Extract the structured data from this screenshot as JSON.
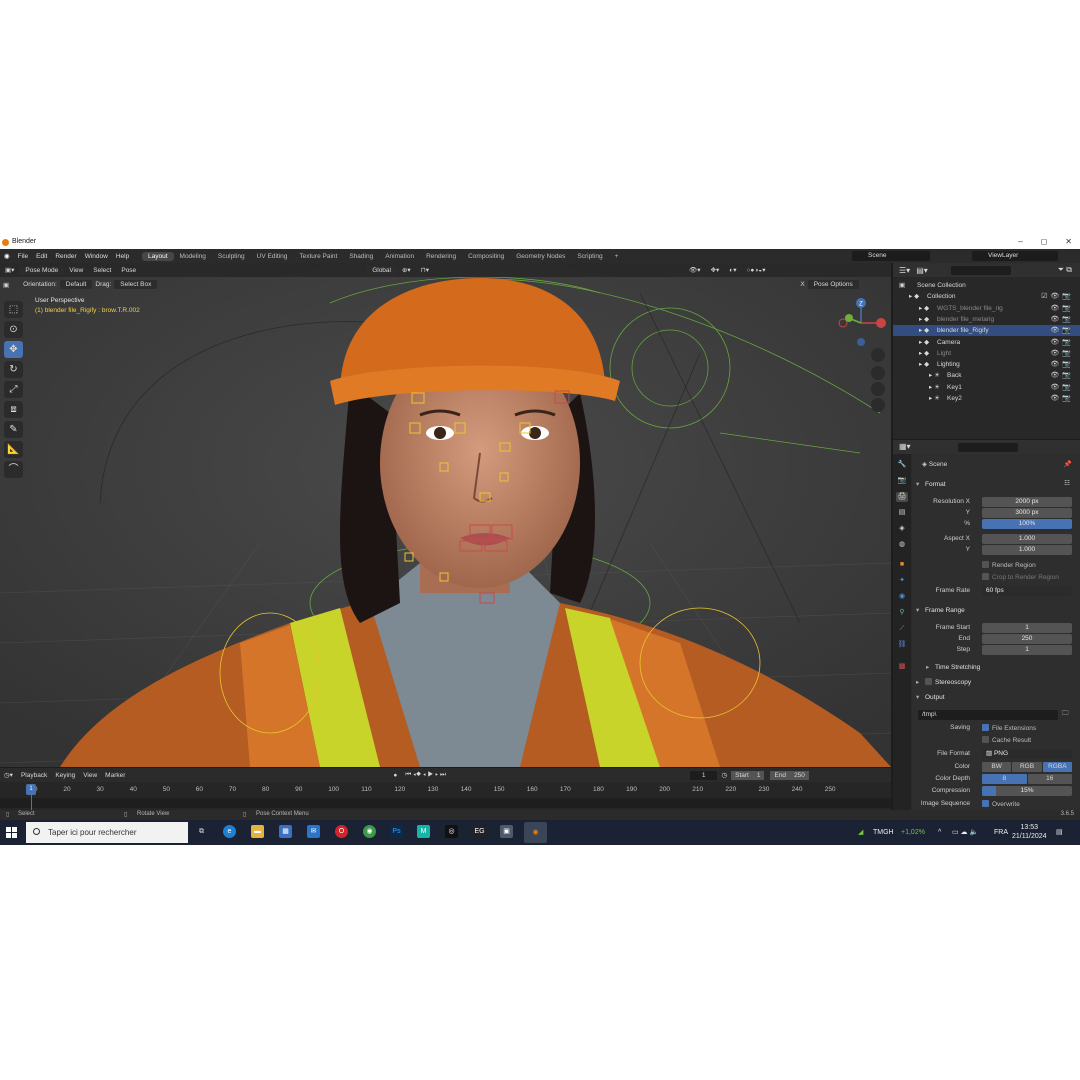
{
  "window": {
    "title": "Blender",
    "controls": [
      "–",
      "◻",
      "✕"
    ]
  },
  "menu": [
    "File",
    "Edit",
    "Render",
    "Window",
    "Help"
  ],
  "workspaces": [
    {
      "label": "Layout",
      "active": true
    },
    {
      "label": "Modeling"
    },
    {
      "label": "Sculpting"
    },
    {
      "label": "UV Editing"
    },
    {
      "label": "Texture Paint"
    },
    {
      "label": "Shading"
    },
    {
      "label": "Animation"
    },
    {
      "label": "Rendering"
    },
    {
      "label": "Compositing"
    },
    {
      "label": "Geometry Nodes"
    },
    {
      "label": "Scripting"
    },
    {
      "label": "+"
    }
  ],
  "scene_name": "Scene",
  "view_layer": "ViewLayer",
  "viewport": {
    "mode": "Pose Mode",
    "menus": [
      "View",
      "Select",
      "Pose"
    ],
    "transform_orientation": "Global",
    "orientation_label": "Orientation:",
    "orientation_value": "Default",
    "drag_label": "Drag:",
    "drag_value": "Select Box",
    "pose_options": "Pose Options",
    "x_label": "X",
    "info_line1": "User Perspective",
    "info_line2": "(1) blender file_Rigify : brow.T.R.002",
    "gizmo_z": "Z"
  },
  "timeline": {
    "menus": [
      "Playback",
      "Keying",
      "View",
      "Marker"
    ],
    "current_frame": "1",
    "start_label": "Start",
    "start": "1",
    "end_label": "End",
    "end": "250",
    "ticks": [
      "1",
      "10",
      "20",
      "30",
      "40",
      "50",
      "60",
      "70",
      "80",
      "90",
      "100",
      "110",
      "120",
      "130",
      "140",
      "150",
      "160",
      "170",
      "180",
      "190",
      "200",
      "210",
      "220",
      "230",
      "240",
      "250"
    ]
  },
  "status": {
    "select": "Select",
    "rotate": "Rotate View",
    "context": "Pose Context Menu",
    "version": "3.6.5"
  },
  "outliner": {
    "rows": [
      {
        "label": "Scene Collection",
        "indent": 0
      },
      {
        "label": "Collection",
        "indent": 1
      },
      {
        "label": "WGTS_blender file_rig",
        "indent": 2,
        "dim": true
      },
      {
        "label": "blender file_metarig",
        "indent": 2,
        "dim": true
      },
      {
        "label": "blender file_Rigify",
        "indent": 2,
        "selected": true
      },
      {
        "label": "Camera",
        "indent": 2
      },
      {
        "label": "Light",
        "indent": 2,
        "dim": true
      },
      {
        "label": "Lighting",
        "indent": 2
      },
      {
        "label": "Back",
        "indent": 3
      },
      {
        "label": "Key1",
        "indent": 3
      },
      {
        "label": "Key2",
        "indent": 3
      }
    ]
  },
  "properties": {
    "context": "Scene",
    "format": {
      "title": "Format",
      "res_x_label": "Resolution X",
      "res_x": "2000 px",
      "res_y_label": "Y",
      "res_y": "3000 px",
      "pct_label": "%",
      "pct": "100%",
      "aspect_x_label": "Aspect X",
      "aspect_x": "1.000",
      "aspect_y_label": "Y",
      "aspect_y": "1.000",
      "render_region": "Render Region",
      "crop": "Crop to Render Region",
      "frame_rate_label": "Frame Rate",
      "frame_rate": "60 fps"
    },
    "frame_range": {
      "title": "Frame Range",
      "start_label": "Frame Start",
      "start": "1",
      "end_label": "End",
      "end": "250",
      "step_label": "Step",
      "step": "1"
    },
    "time_stretching": "Time Stretching",
    "stereoscopy": "Stereoscopy",
    "output": {
      "title": "Output",
      "path": "/tmp\\",
      "saving_label": "Saving",
      "file_ext": "File Extensions",
      "cache": "Cache Result",
      "file_format_label": "File Format",
      "file_format": "PNG",
      "color_label": "Color",
      "color_options": [
        "BW",
        "RGB",
        "RGBA"
      ],
      "color_selected": "RGBA",
      "depth_label": "Color Depth",
      "depth_options": [
        "8",
        "16"
      ],
      "depth_selected": "8",
      "compression_label": "Compression",
      "compression": "15%",
      "compression_fraction": 0.15,
      "image_sequence_label": "Image Sequence",
      "overwrite": "Overwrite"
    }
  },
  "taskbar": {
    "search_placeholder": "Taper ici pour rechercher",
    "stock_ticker": "TMGH",
    "stock_change": "+1,02%",
    "language": "FRA",
    "time": "13:53",
    "date": "21/11/2024"
  },
  "colors": {
    "accent": "#4772b3",
    "selected_row": "#334d80",
    "bone_yellow": "#e8c630",
    "rig_green": "#6fbf40"
  }
}
